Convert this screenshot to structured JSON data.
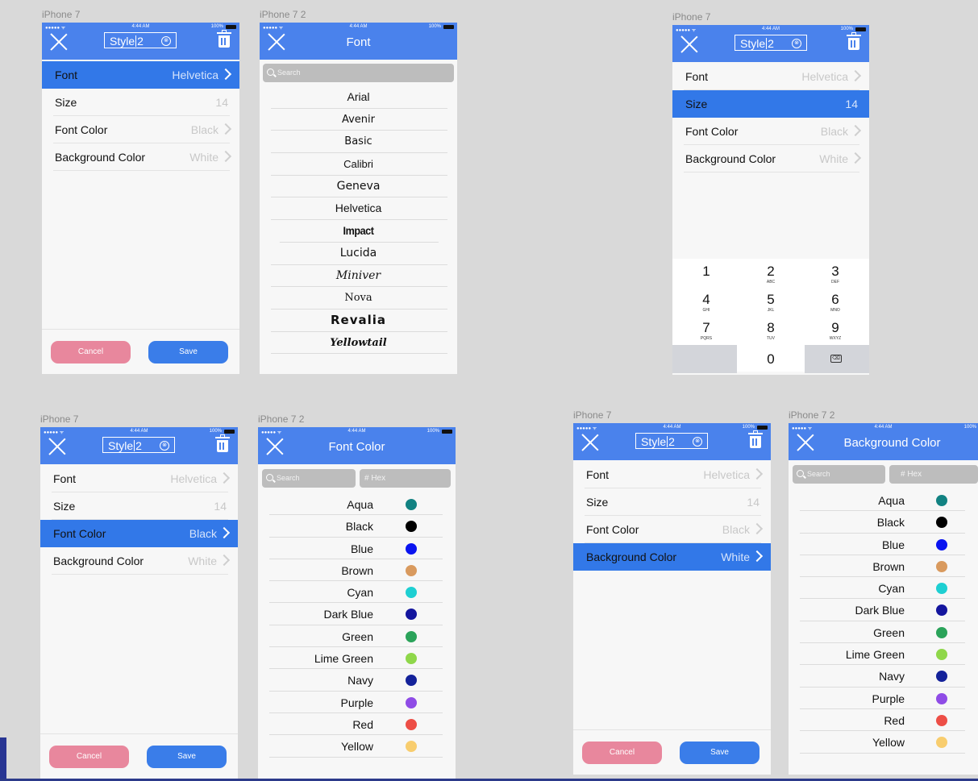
{
  "colors": {
    "accent": "#4a82ec",
    "selected": "#3278e8",
    "cancel": "#e8879d",
    "save": "#3a7de9"
  },
  "status": {
    "signal": "●●●●● ᯤ",
    "time": "4:44 AM",
    "battery": "100%"
  },
  "frames": {
    "f1": {
      "label": "iPhone 7",
      "name_prefix": "Style",
      "name_suffix": "2",
      "clear": "⊗",
      "rows": [
        {
          "label": "Font",
          "value": "Helvetica"
        },
        {
          "label": "Size",
          "value": "14"
        },
        {
          "label": "Font Color",
          "value": "Black"
        },
        {
          "label": "Background Color",
          "value": "White"
        }
      ],
      "cancel": "Cancel",
      "save": "Save"
    },
    "f2": {
      "label": "iPhone 7 2",
      "title": "Font",
      "search_placeholder": "Search",
      "fonts": [
        "Arial",
        "Avenir",
        "Basic",
        "Calibri",
        "Geneva",
        "Helvetica",
        "Impact",
        "Lucida",
        "Miniver",
        "Nova",
        "Revalia",
        "Yellowtail"
      ]
    },
    "f3": {
      "label": "iPhone 7",
      "name_prefix": "Style",
      "name_suffix": "2",
      "clear": "⊗",
      "rows": [
        {
          "label": "Font",
          "value": "Helvetica"
        },
        {
          "label": "Size",
          "value": "14"
        },
        {
          "label": "Font Color",
          "value": "Black"
        },
        {
          "label": "Background Color",
          "value": "White"
        }
      ],
      "keypad": [
        {
          "num": "1",
          "letters": ""
        },
        {
          "num": "2",
          "letters": "ABC"
        },
        {
          "num": "3",
          "letters": "DEF"
        },
        {
          "num": "4",
          "letters": "GHI"
        },
        {
          "num": "5",
          "letters": "JKL"
        },
        {
          "num": "6",
          "letters": "MNO"
        },
        {
          "num": "7",
          "letters": "PQRS"
        },
        {
          "num": "8",
          "letters": "TUV"
        },
        {
          "num": "9",
          "letters": "WXYZ"
        },
        {
          "num": "0",
          "letters": ""
        }
      ],
      "delete_icon": "⌫"
    },
    "f4": {
      "label": "iPhone 7",
      "name_prefix": "Style",
      "name_suffix": "2",
      "clear": "⊗",
      "rows": [
        {
          "label": "Font",
          "value": "Helvetica"
        },
        {
          "label": "Size",
          "value": "14"
        },
        {
          "label": "Font Color",
          "value": "Black"
        },
        {
          "label": "Background Color",
          "value": "White"
        }
      ],
      "cancel": "Cancel",
      "save": "Save"
    },
    "f5": {
      "label": "iPhone 7 2",
      "title": "Font Color",
      "search_placeholder": "Search",
      "hex_placeholder": "# Hex",
      "colors": [
        {
          "name": "Aqua",
          "hex": "#128282"
        },
        {
          "name": "Black",
          "hex": "#000000"
        },
        {
          "name": "Blue",
          "hex": "#0a14f0"
        },
        {
          "name": "Brown",
          "hex": "#d99a5e"
        },
        {
          "name": "Cyan",
          "hex": "#1ecfd2"
        },
        {
          "name": "Dark Blue",
          "hex": "#14169e"
        },
        {
          "name": "Green",
          "hex": "#2ba35a"
        },
        {
          "name": "Lime Green",
          "hex": "#8fd74a"
        },
        {
          "name": "Navy",
          "hex": "#14229a"
        },
        {
          "name": "Purple",
          "hex": "#8f4ce6"
        },
        {
          "name": "Red",
          "hex": "#ed4e46"
        },
        {
          "name": "Yellow",
          "hex": "#f8cd6e"
        }
      ]
    },
    "f6": {
      "label": "iPhone 7",
      "name_prefix": "Style",
      "name_suffix": "2",
      "clear": "⊗",
      "rows": [
        {
          "label": "Font",
          "value": "Helvetica"
        },
        {
          "label": "Size",
          "value": "14"
        },
        {
          "label": "Font Color",
          "value": "Black"
        },
        {
          "label": "Background Color",
          "value": "White"
        }
      ],
      "cancel": "Cancel",
      "save": "Save"
    },
    "f7": {
      "label": "iPhone 7 2",
      "title": "Background Color",
      "search_placeholder": "Search",
      "hex_placeholder": "# Hex",
      "colors": [
        {
          "name": "Aqua",
          "hex": "#128282"
        },
        {
          "name": "Black",
          "hex": "#000000"
        },
        {
          "name": "Blue",
          "hex": "#0a14f0"
        },
        {
          "name": "Brown",
          "hex": "#d99a5e"
        },
        {
          "name": "Cyan",
          "hex": "#1ecfd2"
        },
        {
          "name": "Dark Blue",
          "hex": "#14169e"
        },
        {
          "name": "Green",
          "hex": "#2ba35a"
        },
        {
          "name": "Lime Green",
          "hex": "#8fd74a"
        },
        {
          "name": "Navy",
          "hex": "#14229a"
        },
        {
          "name": "Purple",
          "hex": "#8f4ce6"
        },
        {
          "name": "Red",
          "hex": "#ed4e46"
        },
        {
          "name": "Yellow",
          "hex": "#f8cd6e"
        }
      ]
    }
  }
}
